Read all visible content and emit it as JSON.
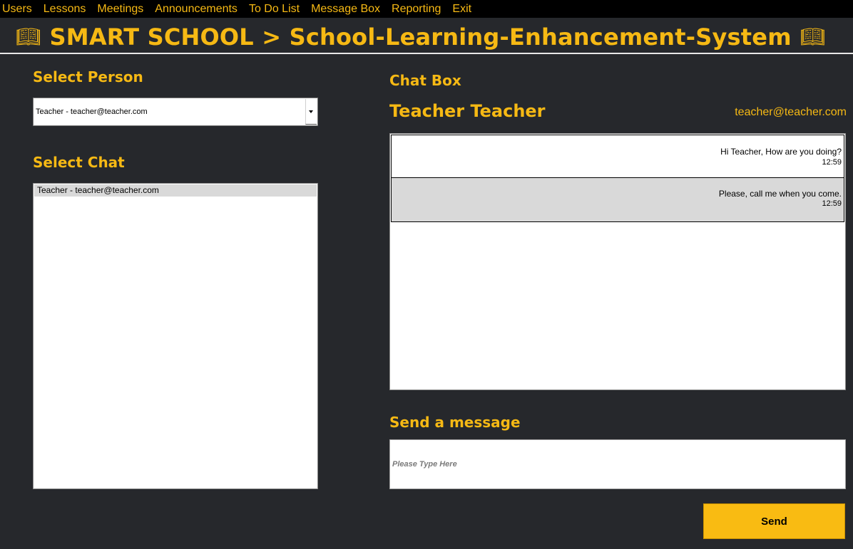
{
  "menu": [
    "Users",
    "Lessons",
    "Meetings",
    "Announcements",
    "To Do List",
    "Message Box",
    "Reporting",
    "Exit"
  ],
  "header": {
    "title": "SMART SCHOOL > School-Learning-Enhancement-System",
    "icon_left": "book-icon",
    "icon_right": "book-icon"
  },
  "select_person": {
    "label": "Select  Person",
    "value": "Teacher - teacher@teacher.com"
  },
  "select_chat": {
    "label": "Select  Chat",
    "items": [
      "Teacher - teacher@teacher.com"
    ]
  },
  "chat_box": {
    "label": "Chat Box",
    "contact_name": "Teacher Teacher",
    "contact_email": "teacher@teacher.com",
    "messages": [
      {
        "text": "Hi Teacher, How are you doing?",
        "time": "12:59"
      },
      {
        "text": "Please, call  me when you come.",
        "time": "12:59"
      }
    ]
  },
  "send": {
    "label": "Send a message",
    "placeholder": "Please Type Here",
    "button": "Send"
  },
  "colors": {
    "accent": "#f6b914",
    "background": "#26282c",
    "menubar": "#000000",
    "button": "#f9bb12"
  }
}
